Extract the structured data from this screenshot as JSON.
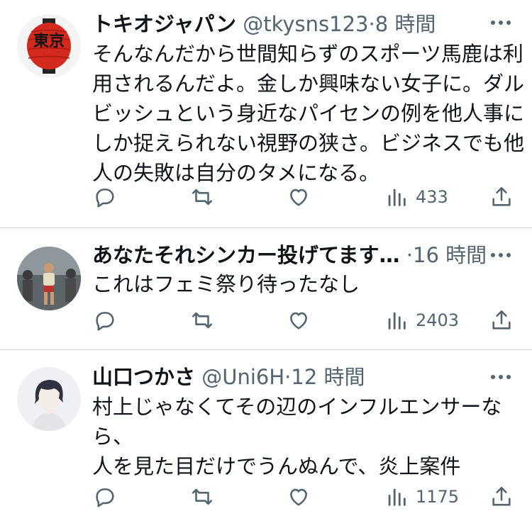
{
  "tweets": [
    {
      "name": "トキオジャパン",
      "handle": "@tkysns123",
      "separator": "·",
      "time": "8 時間",
      "lines": [
        "そんなんだから世間知らずのスポーツ馬鹿は利",
        "用されるんだよ。金しか興味ない女子に。ダル",
        "ビッシュという身近なパイセンの例を他人事に",
        "しか捉えられない視野の狭さ。ビジネスでも他",
        "人の失敗は自分のタメになる。"
      ],
      "views": "433",
      "avatar_icon": "red-lantern-tokyo",
      "avatar_text": "東京"
    },
    {
      "name": "あなたそれシンカー投げてます…",
      "handle": "",
      "separator": "·",
      "time": "16 時間",
      "lines": [
        "これはフェミ祭り待ったなし"
      ],
      "views": "2403",
      "avatar_icon": "runner-photo"
    },
    {
      "name": "山口つかさ",
      "handle": "@Uni6H",
      "separator": "·",
      "time": "12 時間",
      "lines": [
        "村上じゃなくてその辺のインフルエンサーな",
        "ら、",
        "人を見た目だけでうんぬんで、炎上案件"
      ],
      "views": "1175",
      "avatar_icon": "anime-boy-illustration"
    }
  ],
  "colors": {
    "text": "#0f1419",
    "secondary": "#536471",
    "divider": "#cfd9de",
    "lantern_red": "#d42a1e"
  },
  "icons": [
    "reply-icon",
    "retweet-icon",
    "like-icon",
    "views-icon",
    "share-icon",
    "more-icon"
  ]
}
